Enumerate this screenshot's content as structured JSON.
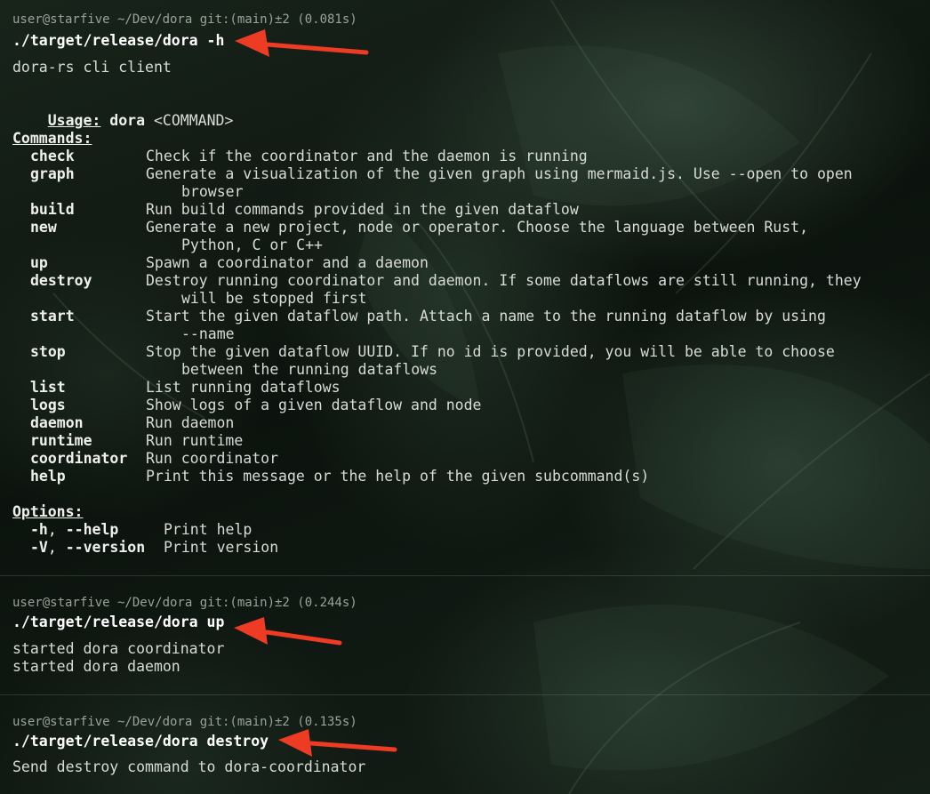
{
  "blocks": [
    {
      "prompt": "user@starfive ~/Dev/dora git:(main)±2 (0.081s)",
      "command": "./target/release/dora -h"
    },
    {
      "prompt": "user@starfive ~/Dev/dora git:(main)±2 (0.244s)",
      "command": "./target/release/dora up",
      "output": [
        "started dora coordinator",
        "started dora daemon"
      ]
    },
    {
      "prompt": "user@starfive ~/Dev/dora git:(main)±2 (0.135s)",
      "command": "./target/release/dora destroy",
      "output": [
        "Send destroy command to dora-coordinator"
      ]
    }
  ],
  "help": {
    "about": "dora-rs cli client",
    "usage_label": "Usage:",
    "usage_bin": "dora",
    "usage_args": "<COMMAND>",
    "commands_label": "Commands:",
    "commands": [
      {
        "name": "check",
        "desc": "Check if the coordinator and the daemon is running"
      },
      {
        "name": "graph",
        "desc": "Generate a visualization of the given graph using mermaid.js. Use --open to open",
        "cont": "browser"
      },
      {
        "name": "build",
        "desc": "Run build commands provided in the given dataflow"
      },
      {
        "name": "new",
        "desc": "Generate a new project, node or operator. Choose the language between Rust,",
        "cont": "Python, C or C++"
      },
      {
        "name": "up",
        "desc": "Spawn a coordinator and a daemon"
      },
      {
        "name": "destroy",
        "desc": "Destroy running coordinator and daemon. If some dataflows are still running, they",
        "cont": "will be stopped first"
      },
      {
        "name": "start",
        "desc": "Start the given dataflow path. Attach a name to the running dataflow by using",
        "cont": "--name"
      },
      {
        "name": "stop",
        "desc": "Stop the given dataflow UUID. If no id is provided, you will be able to choose",
        "cont": "between the running dataflows"
      },
      {
        "name": "list",
        "desc": "List running dataflows"
      },
      {
        "name": "logs",
        "desc": "Show logs of a given dataflow and node"
      },
      {
        "name": "daemon",
        "desc": "Run daemon"
      },
      {
        "name": "runtime",
        "desc": "Run runtime"
      },
      {
        "name": "coordinator",
        "desc": "Run coordinator"
      },
      {
        "name": "help",
        "desc": "Print this message or the help of the given subcommand(s)"
      }
    ],
    "options_label": "Options:",
    "options": [
      {
        "short": "-h",
        "sep": ", ",
        "long": "--help",
        "desc": "Print help"
      },
      {
        "short": "-V",
        "sep": ", ",
        "long": "--version",
        "desc": "Print version"
      }
    ]
  },
  "colors": {
    "arrow": "#ee3b24",
    "prompt": "#9aa29c"
  }
}
